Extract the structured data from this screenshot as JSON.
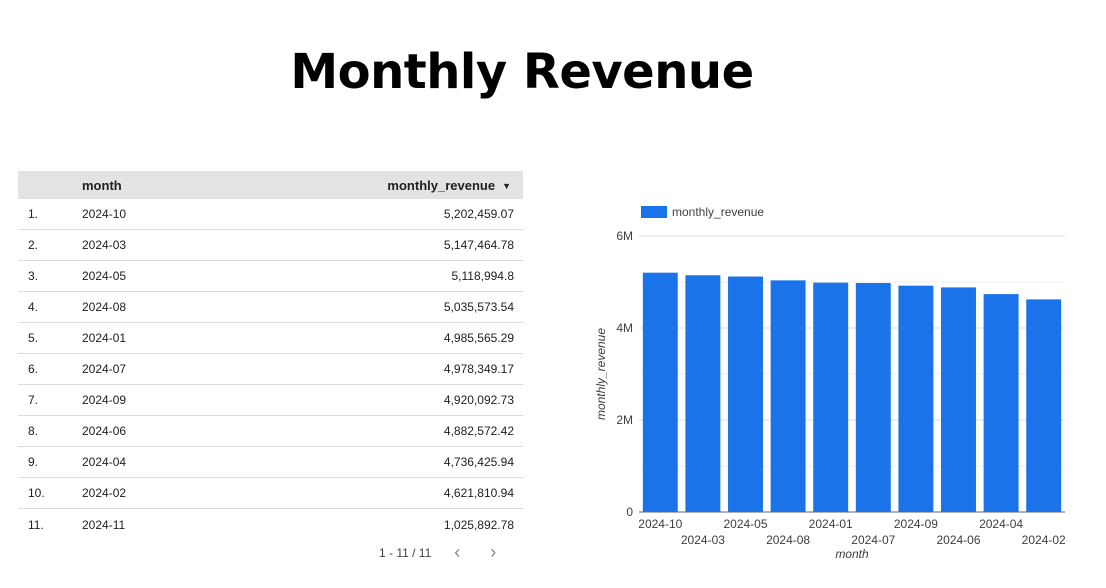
{
  "page": {
    "title": "Monthly Revenue"
  },
  "table": {
    "columns": [
      "month",
      "monthly_revenue"
    ],
    "sort_indicator": "▼",
    "rows": [
      {
        "idx": "1.",
        "month": "2024-10",
        "revenue": "5,202,459.07"
      },
      {
        "idx": "2.",
        "month": "2024-03",
        "revenue": "5,147,464.78"
      },
      {
        "idx": "3.",
        "month": "2024-05",
        "revenue": "5,118,994.8"
      },
      {
        "idx": "4.",
        "month": "2024-08",
        "revenue": "5,035,573.54"
      },
      {
        "idx": "5.",
        "month": "2024-01",
        "revenue": "4,985,565.29"
      },
      {
        "idx": "6.",
        "month": "2024-07",
        "revenue": "4,978,349.17"
      },
      {
        "idx": "7.",
        "month": "2024-09",
        "revenue": "4,920,092.73"
      },
      {
        "idx": "8.",
        "month": "2024-06",
        "revenue": "4,882,572.42"
      },
      {
        "idx": "9.",
        "month": "2024-04",
        "revenue": "4,736,425.94"
      },
      {
        "idx": "10.",
        "month": "2024-02",
        "revenue": "4,621,810.94"
      },
      {
        "idx": "11.",
        "month": "2024-11",
        "revenue": "1,025,892.78"
      }
    ],
    "pagination": {
      "label": "1 - 11 / 11",
      "prev_icon": "chevron-left-icon",
      "next_icon": "chevron-right-icon"
    }
  },
  "chart_data": {
    "type": "bar",
    "categories": [
      "2024-10",
      "2024-03",
      "2024-05",
      "2024-08",
      "2024-01",
      "2024-07",
      "2024-09",
      "2024-06",
      "2024-04",
      "2024-02"
    ],
    "series": [
      {
        "name": "monthly_revenue",
        "values": [
          5202459.07,
          5147464.78,
          5118994.8,
          5035573.54,
          4985565.29,
          4978349.17,
          4920092.73,
          4882572.42,
          4736425.94,
          4621810.94
        ]
      }
    ],
    "xlabel": "month",
    "ylabel": "monthly_revenue",
    "ylim": [
      0,
      6000000
    ],
    "yticks": [
      0,
      2000000,
      4000000,
      6000000
    ],
    "ytick_labels": [
      "0",
      "2M",
      "4M",
      "6M"
    ],
    "grid": true,
    "legend": "top-left",
    "color": "#1a73e8"
  }
}
